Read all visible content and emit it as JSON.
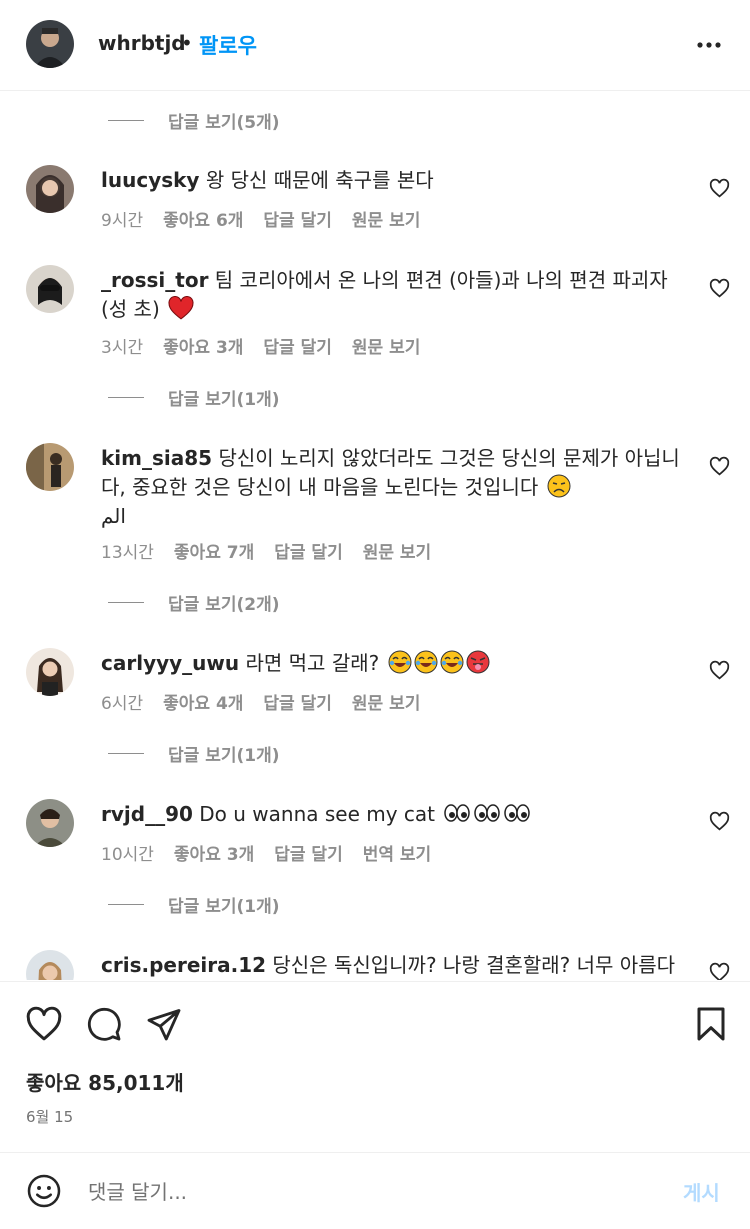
{
  "header": {
    "username": "whrbtjd",
    "separator": "•",
    "follow_label": "팔로우"
  },
  "comments": [
    {
      "view_replies_before": "답글 보기(5개)"
    },
    {
      "username": "luucysky",
      "text": "왕 당신 때문에 축구를 본다",
      "time": "9시간",
      "likes": "좋아요 6개",
      "reply": "답글 달기",
      "translate": "원문 보기"
    },
    {
      "username": "_rossi_tor",
      "text": "팀 코리아에서 온 나의 편견 (아들)과 나의 편견 파괴자 (성 초)",
      "time": "3시간",
      "likes": "좋아요 3개",
      "reply": "답글 달기",
      "translate": "원문 보기",
      "view_replies": "답글 보기(1개)"
    },
    {
      "username": "kim_sia85",
      "text": "당신이 노리지 않았더라도 그것은 당신의 문제가 아닙니다, 중요한 것은 당신이 내 마음을 노린다는 것입니다",
      "text_tail": "الم",
      "time": "13시간",
      "likes": "좋아요 7개",
      "reply": "답글 달기",
      "translate": "원문 보기",
      "view_replies": "답글 보기(2개)"
    },
    {
      "username": "carlyyy_uwu",
      "text": "라면 먹고 갈래?",
      "time": "6시간",
      "likes": "좋아요 4개",
      "reply": "답글 달기",
      "translate": "원문 보기",
      "view_replies": "답글 보기(1개)"
    },
    {
      "username": "rvjd__90",
      "text": "Do u wanna see my cat",
      "time": "10시간",
      "likes": "좋아요 3개",
      "reply": "답글 달기",
      "translate": "번역 보기",
      "view_replies": "답글 보기(1개)"
    },
    {
      "username": "cris.pereira.12",
      "text": "당신은 독신입니까? 나랑 결혼할래? 너무 아름다"
    }
  ],
  "post": {
    "likes": "좋아요 85,011개",
    "date": "6월 15"
  },
  "composer": {
    "placeholder": "댓글 달기...",
    "post_label": "게시"
  },
  "colors": {
    "accent": "#0095f6",
    "muted": "#8e8e8e",
    "post_disabled": "#b3dbff",
    "heart_red": "#ed4956"
  }
}
